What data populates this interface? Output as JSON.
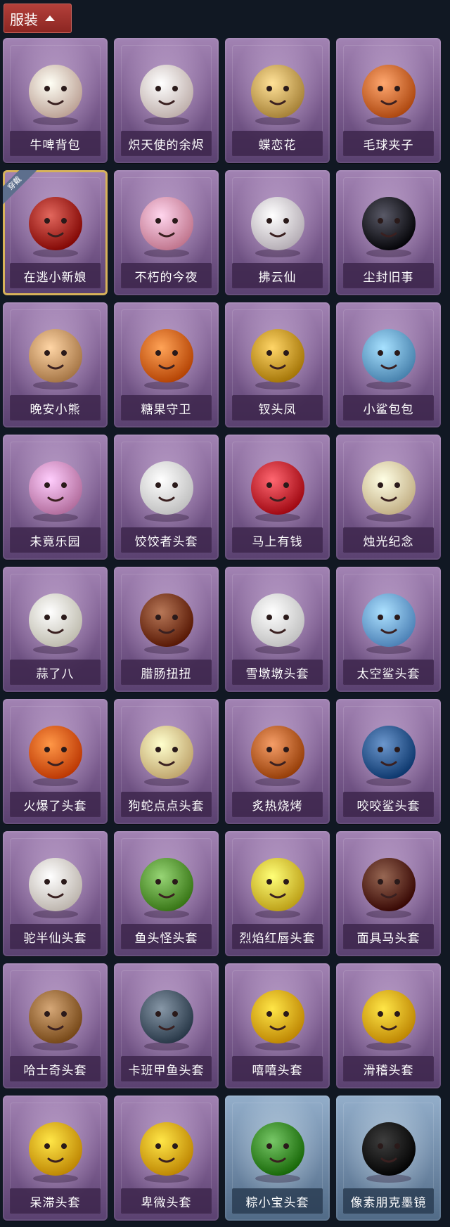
{
  "header": {
    "label": "服装"
  },
  "items": [
    {
      "name": "牛啤背包",
      "color": "#f0d4c8",
      "icon": "beer-cow-backpack-icon",
      "frame": "purple"
    },
    {
      "name": "炽天使的余烬",
      "color": "#f3e3df",
      "icon": "angel-doll-icon",
      "frame": "purple"
    },
    {
      "name": "蝶恋花",
      "color": "#d9b46a",
      "icon": "bell-wreath-icon",
      "frame": "purple"
    },
    {
      "name": "毛球夹子",
      "color": "#e07a42",
      "icon": "raccoon-drummer-icon",
      "frame": "purple"
    },
    {
      "name": "在逃小新娘",
      "color": "#b53a30",
      "icon": "red-lamp-icon",
      "frame": "purple",
      "badge": "穿戴",
      "equipped": true
    },
    {
      "name": "不朽的今夜",
      "color": "#f4a8c0",
      "icon": "pink-cat-cup-icon",
      "frame": "purple"
    },
    {
      "name": "拂云仙",
      "color": "#e8e0e8",
      "icon": "fairy-charm-icon",
      "frame": "purple"
    },
    {
      "name": "尘封旧事",
      "color": "#2c2c3a",
      "icon": "prince-doll-icon",
      "frame": "purple"
    },
    {
      "name": "晚安小熊",
      "color": "#d8a878",
      "icon": "bear-charm-icon",
      "frame": "purple"
    },
    {
      "name": "糖果守卫",
      "color": "#e8762a",
      "icon": "pumpkin-scarecrow-icon",
      "frame": "purple"
    },
    {
      "name": "钗头凤",
      "color": "#d7a83a",
      "icon": "phoenix-crown-girl-icon",
      "frame": "purple"
    },
    {
      "name": "小鲨包包",
      "color": "#7ab4e0",
      "icon": "shark-bag-icon",
      "frame": "purple"
    },
    {
      "name": "未竟乐园",
      "color": "#e6a0d0",
      "icon": "star-girl-icon",
      "frame": "purple"
    },
    {
      "name": "饺饺者头套",
      "color": "#f4f4f4",
      "icon": "dumpling-head-icon",
      "frame": "purple"
    },
    {
      "name": "马上有钱",
      "color": "#d23a44",
      "icon": "red-horse-head-icon",
      "frame": "purple"
    },
    {
      "name": "烛光纪念",
      "color": "#f7e3b8",
      "icon": "candle-head-icon",
      "frame": "purple"
    },
    {
      "name": "蒜了八",
      "color": "#f3f0e2",
      "icon": "garlic-head-icon",
      "frame": "purple"
    },
    {
      "name": "腊肠扭扭",
      "color": "#8a4a2a",
      "icon": "dachshund-head-icon",
      "frame": "purple"
    },
    {
      "name": "雪墩墩头套",
      "color": "#f5f5f5",
      "icon": "snowman-head-icon",
      "frame": "purple"
    },
    {
      "name": "太空鲨头套",
      "color": "#7fb4ea",
      "icon": "space-shark-head-icon",
      "frame": "purple"
    },
    {
      "name": "火爆了头套",
      "color": "#f06a1a",
      "icon": "fire-head-icon",
      "frame": "purple"
    },
    {
      "name": "狗蛇点点头套",
      "color": "#f4d8a0",
      "icon": "snake-head-icon",
      "frame": "purple"
    },
    {
      "name": "炙热烧烤",
      "color": "#c8703a",
      "icon": "meat-head-icon",
      "frame": "purple"
    },
    {
      "name": "咬咬鲨头套",
      "color": "#3f6aa0",
      "icon": "biting-shark-head-icon",
      "frame": "purple"
    },
    {
      "name": "驼半仙头套",
      "color": "#f0e8e0",
      "icon": "alpaca-sunglasses-head-icon",
      "frame": "purple"
    },
    {
      "name": "鱼头怪头套",
      "color": "#6aa848",
      "icon": "fish-head-mask-icon",
      "frame": "purple"
    },
    {
      "name": "烈焰红唇头套",
      "color": "#f0d24a",
      "icon": "yellow-mascot-head-icon",
      "frame": "purple"
    },
    {
      "name": "面具马头套",
      "color": "#6a3a26",
      "icon": "horse-mask-head-icon",
      "frame": "purple"
    },
    {
      "name": "哈士奇头套",
      "color": "#a87a4a",
      "icon": "husky-head-icon",
      "frame": "purple"
    },
    {
      "name": "卡班甲鱼头套",
      "color": "#5a6a7a",
      "icon": "turtle-head-icon",
      "frame": "purple"
    },
    {
      "name": "嘻嘻头套",
      "color": "#f2b91a",
      "icon": "grin-emoji-head-icon",
      "frame": "purple"
    },
    {
      "name": "滑稽头套",
      "color": "#f2b91a",
      "icon": "funny-emoji-head-icon",
      "frame": "purple"
    },
    {
      "name": "呆滞头套",
      "color": "#f2b91a",
      "icon": "dazed-emoji-head-icon",
      "frame": "purple"
    },
    {
      "name": "卑微头套",
      "color": "#f2b91a",
      "icon": "humble-emoji-head-icon",
      "frame": "purple"
    },
    {
      "name": "粽小宝头套",
      "color": "#4a9a3a",
      "icon": "zongzi-head-icon",
      "frame": "blue"
    },
    {
      "name": "像素朋克墨镜",
      "color": "#111111",
      "icon": "pixel-sunglasses-icon",
      "frame": "blue"
    }
  ]
}
